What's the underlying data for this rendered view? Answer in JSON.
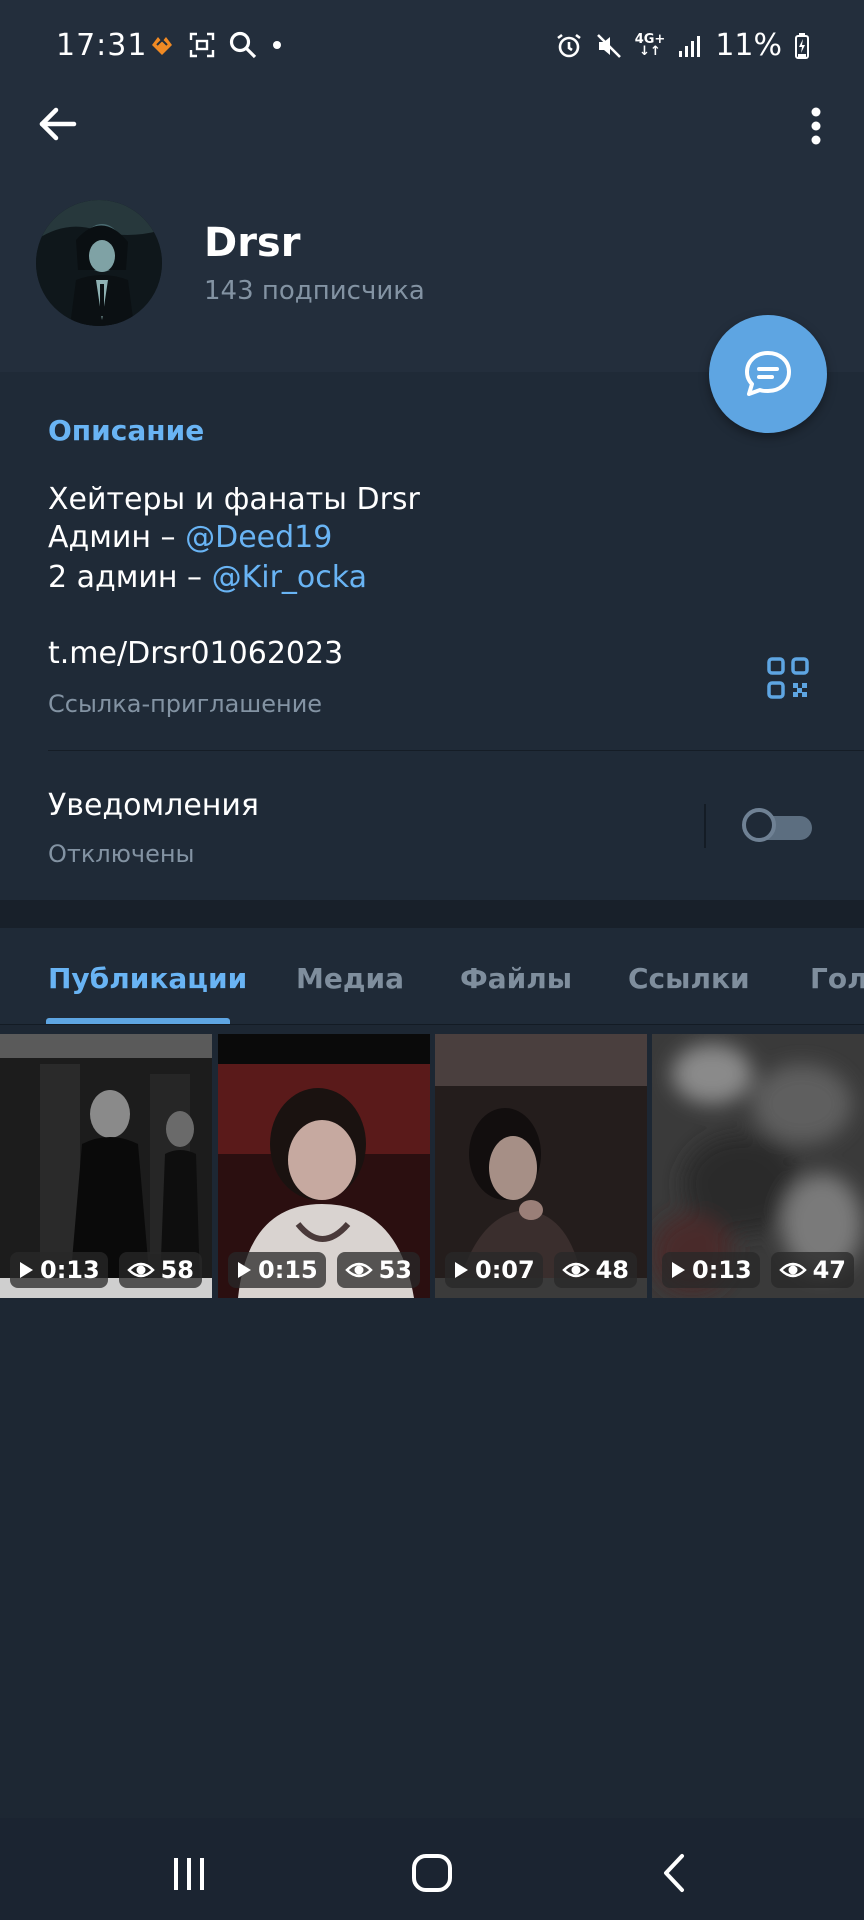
{
  "status": {
    "time": "17:31",
    "network": "4G+",
    "battery": "11%"
  },
  "header": {
    "back_icon": "arrow-left-icon",
    "menu_icon": "more-vertical-icon",
    "channel_name": "Drsr",
    "subscribers": "143 подписчика",
    "fab_icon": "chat-bubble-icon"
  },
  "info": {
    "description_title": "Описание",
    "description_line1": "Хейтеры и фанаты Drsr",
    "admin1_prefix": "Админ – ",
    "admin1_mention": "@Deed19",
    "admin2_prefix": "2 админ – ",
    "admin2_mention": "@Kir_ocka",
    "link": "t.me/Drsr01062023",
    "link_caption": "Ссылка-приглашение",
    "notifications_title": "Уведомления",
    "notifications_state": "Отключены",
    "notifications_enabled": false
  },
  "tabs": [
    {
      "label": "Публикации",
      "active": true
    },
    {
      "label": "Медиа",
      "active": false
    },
    {
      "label": "Файлы",
      "active": false
    },
    {
      "label": "Ссылки",
      "active": false
    },
    {
      "label": "Голо",
      "active": false
    }
  ],
  "media": [
    {
      "duration": "0:13",
      "views": "58"
    },
    {
      "duration": "0:15",
      "views": "53"
    },
    {
      "duration": "0:07",
      "views": "48"
    },
    {
      "duration": "0:13",
      "views": "47"
    }
  ],
  "colors": {
    "accent": "#5ea5e2",
    "link": "#69b4f4",
    "background": "#1d2733",
    "header": "#232e3c"
  }
}
